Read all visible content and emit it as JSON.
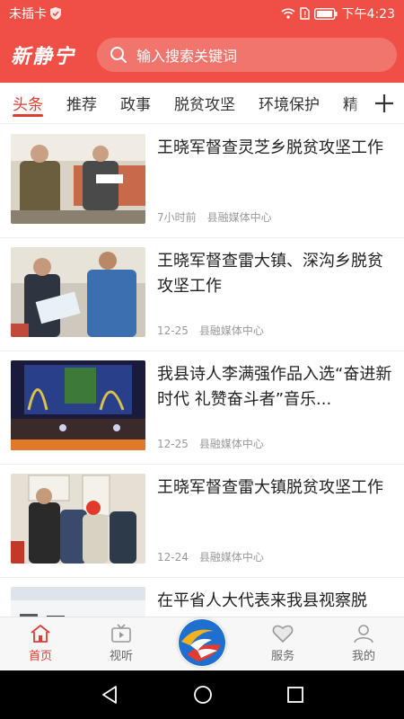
{
  "status_bar": {
    "carrier": "未插卡",
    "time": "下午4:23"
  },
  "header": {
    "logo_text": "新静宁",
    "search_placeholder": "输入搜索关键词",
    "colors": {
      "brand": "#ef4f44",
      "accent": "#e23b2f"
    }
  },
  "tabs": [
    "头条",
    "推荐",
    "政事",
    "脱贫攻坚",
    "环境保护",
    "精"
  ],
  "tab_more_icon": "plus-icon",
  "feed": [
    {
      "title": "王晓军督查灵芝乡脱贫攻坚工作",
      "time": "7小时前",
      "source": "县融媒体中心"
    },
    {
      "title": "王晓军督查雷大镇、深沟乡脱贫攻坚工作",
      "time": "12-25",
      "source": "县融媒体中心"
    },
    {
      "title": "我县诗人李满强作品入选“奋进新时代 礼赞奋斗者”音乐...",
      "time": "12-25",
      "source": "县融媒体中心"
    },
    {
      "title": "王晓军督查雷大镇脱贫攻坚工作",
      "time": "12-24",
      "source": "县融媒体中心"
    },
    {
      "title": "在平省人大代表来我县视察脱",
      "time": "",
      "source": ""
    }
  ],
  "bottom_nav": [
    {
      "label": "首页",
      "icon": "home-icon"
    },
    {
      "label": "视听",
      "icon": "tv-icon"
    },
    {
      "label": "服务",
      "icon": "heart-icon"
    },
    {
      "label": "我的",
      "icon": "user-icon"
    }
  ]
}
